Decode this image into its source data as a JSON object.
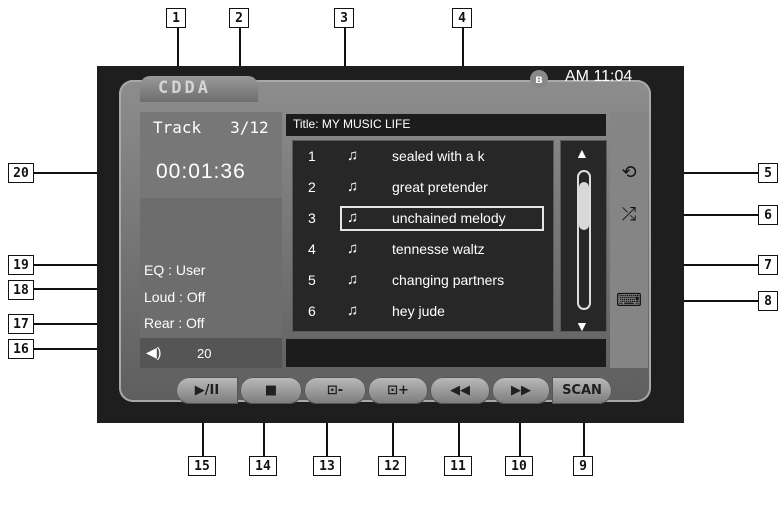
{
  "app": {
    "logo": "CDDA",
    "clock": "AM 11:04",
    "bluetooth_icon": "bluetooth-icon"
  },
  "now_playing": {
    "track_label": "Track",
    "track_number": "3/12",
    "elapsed_time": "00:01:36",
    "title": "Title: MY  MUSIC LIFE"
  },
  "settings": {
    "eq": "EQ   : User",
    "loud": "Loud : Off",
    "rear": "Rear : Off"
  },
  "volume": {
    "icon": "speaker-icon",
    "value": "20"
  },
  "playlist": [
    {
      "num": "1",
      "name": "sealed with a k"
    },
    {
      "num": "2",
      "name": "great pretender"
    },
    {
      "num": "3",
      "name": "unchained melody",
      "selected": true
    },
    {
      "num": "4",
      "name": "tennesse waltz"
    },
    {
      "num": "5",
      "name": "changing partners"
    },
    {
      "num": "6",
      "name": "hey jude"
    }
  ],
  "side_buttons": {
    "repeat": "repeat-icon",
    "shuffle": "shuffle-icon",
    "keyboard": "keyboard-icon"
  },
  "controls": {
    "play_pause": "▶/II",
    "stop": "■",
    "prev_folder": "⊡-",
    "next_folder": "⊡+",
    "rewind": "◀◀",
    "forward": "▶▶",
    "scan": "SCAN"
  },
  "callouts": [
    "1",
    "2",
    "3",
    "4",
    "5",
    "6",
    "7",
    "8",
    "9",
    "10",
    "11",
    "12",
    "13",
    "14",
    "15",
    "16",
    "17",
    "18",
    "19",
    "20"
  ]
}
